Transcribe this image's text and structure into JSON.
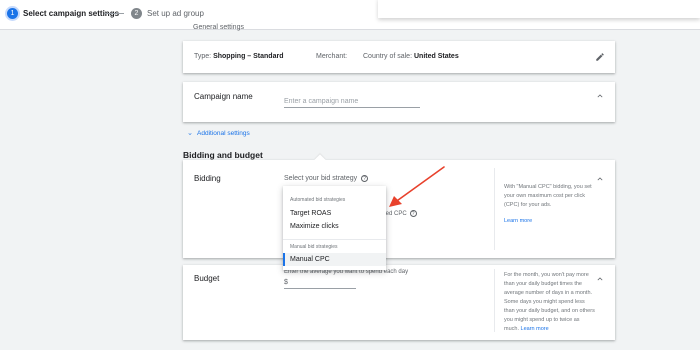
{
  "stepper": {
    "step1": {
      "number": "1",
      "label": "Select campaign settings"
    },
    "step2": {
      "number": "2",
      "label": "Set up ad group"
    }
  },
  "general_settings": {
    "title": "General settings"
  },
  "type_card": {
    "type_label": "Type:",
    "type_value": "Shopping – Standard",
    "merchant_label": "Merchant:",
    "country_label": "Country of sale:",
    "country_value": "United States",
    "edit_icon": "pencil-icon"
  },
  "campaign_name": {
    "label": "Campaign name",
    "placeholder": "Enter a campaign name"
  },
  "additional_settings": {
    "label": "Additional settings"
  },
  "bidding_budget": {
    "title": "Bidding and budget",
    "underline_color": "#d93025"
  },
  "bidding": {
    "label": "Bidding",
    "strategy_prompt": "Select your bid strategy",
    "enhanced_cpc_partial": "anced CPC",
    "side_note": "With \"Manual CPC\" bidding, you set your own maximum cost per click (CPC) for your ads.",
    "learn_more": "Learn more"
  },
  "dropdown": {
    "group_automated": "Automated bid strategies",
    "items_automated": [
      "Target ROAS",
      "Maximize clicks"
    ],
    "group_manual": "Manual bid strategies",
    "items_manual": [
      "Manual CPC"
    ],
    "selected": "Manual CPC"
  },
  "budget": {
    "label": "Budget",
    "description": "Enter the average you want to spend each day",
    "currency_symbol": "$",
    "side_note": "For the month, you won't pay more than your daily budget times the average number of days in a month. Some days you might spend less than your daily budget, and on others you might spend up to twice as much.",
    "learn_more": "Learn more"
  },
  "colors": {
    "accent": "#1a73e8",
    "annotation_arrow": "#e8412c"
  }
}
